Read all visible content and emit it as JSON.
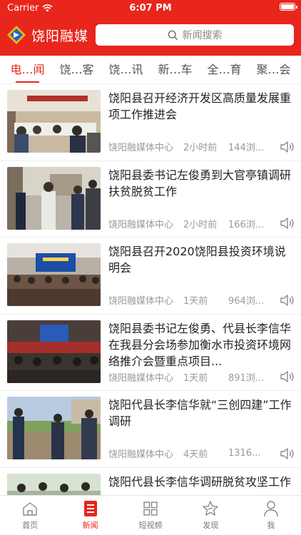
{
  "status": {
    "carrier": "Carrier",
    "time": "6:07 PM"
  },
  "header": {
    "logo_text": "饶阳融媒",
    "search_placeholder": "新闻搜索"
  },
  "tabs": [
    {
      "label": "电…闻",
      "active": true
    },
    {
      "label": "饶…客",
      "active": false
    },
    {
      "label": "饶…讯",
      "active": false
    },
    {
      "label": "新…车",
      "active": false
    },
    {
      "label": "全…育",
      "active": false
    },
    {
      "label": "聚…会",
      "active": false
    }
  ],
  "news": [
    {
      "title": "饶阳县召开经济开发区高质量发展重项工作推进会",
      "source": "饶阳融媒体中心",
      "time": "2小时前",
      "views": "144浏..."
    },
    {
      "title": "饶阳县委书记左俊勇到大官亭镇调研扶贫脱贫工作",
      "source": "饶阳融媒体中心",
      "time": "2小时前",
      "views": "166浏..."
    },
    {
      "title": "饶阳县召开2020饶阳县投资环境说明会",
      "source": "饶阳融媒体中心",
      "time": "1天前",
      "views": "964浏..."
    },
    {
      "title": "饶阳县委书记左俊勇、代县长李信华在我县分会场参加衡水市投资环境网络推介会暨重点项目...",
      "source": "饶阳融媒体中心",
      "time": "1天前",
      "views": "891浏..."
    },
    {
      "title": "饶阳代县长李信华就“三创四建”工作调研",
      "source": "饶阳融媒体中心",
      "time": "4天前",
      "views": "1316..."
    },
    {
      "title": "饶阳代县长李信华调研脱贫攻坚工作",
      "source": "",
      "time": "",
      "views": ""
    }
  ],
  "tabbar": [
    {
      "label": "首页",
      "icon": "home-icon",
      "active": false
    },
    {
      "label": "新闻",
      "icon": "news-icon",
      "active": true
    },
    {
      "label": "短视频",
      "icon": "grid-icon",
      "active": false
    },
    {
      "label": "发现",
      "icon": "star-icon",
      "active": false
    },
    {
      "label": "我",
      "icon": "user-icon",
      "active": false
    }
  ],
  "colors": {
    "brand_red": "#e8261c",
    "meta_gray": "#999999"
  }
}
